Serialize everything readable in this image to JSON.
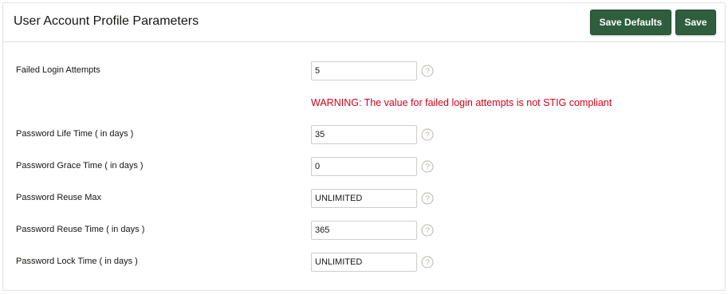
{
  "header": {
    "title": "User Account Profile Parameters",
    "save_defaults_label": "Save Defaults",
    "save_label": "Save"
  },
  "fields": [
    {
      "label": "Failed Login Attempts",
      "value": "5"
    },
    {
      "label": "Password Life Time ( in days )",
      "value": "35"
    },
    {
      "label": "Password Grace Time ( in days )",
      "value": "0"
    },
    {
      "label": "Password Reuse Max",
      "value": "UNLIMITED"
    },
    {
      "label": "Password Reuse Time ( in days )",
      "value": "365"
    },
    {
      "label": "Password Lock Time ( in days )",
      "value": "UNLIMITED"
    }
  ],
  "warning": {
    "text": "WARNING: The value for failed login attempts is not STIG compliant",
    "color": "#d0021b"
  },
  "icons": {
    "help": "help-circle-icon"
  },
  "colors": {
    "button": "#2f5e3f",
    "button_text": "#ffffff"
  }
}
